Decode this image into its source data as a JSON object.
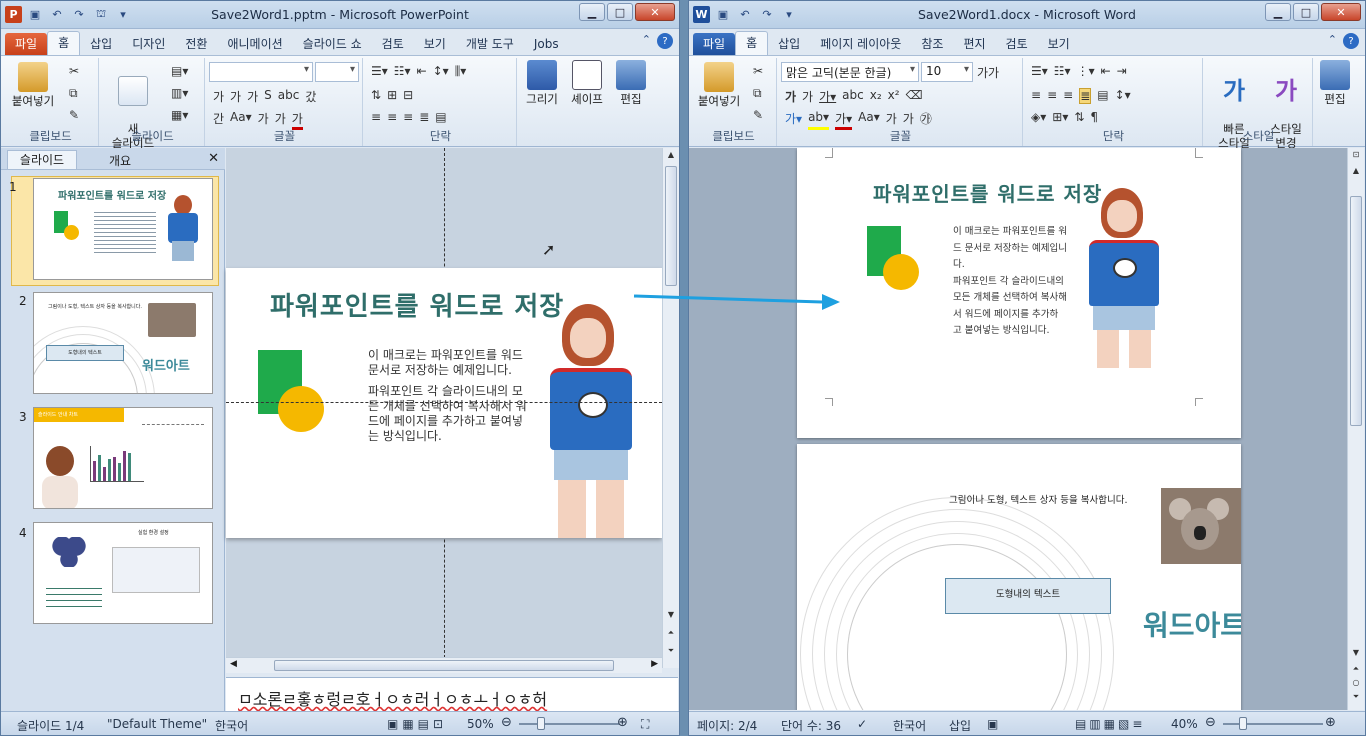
{
  "ppt": {
    "title": "Save2Word1.pptm  -  Microsoft PowerPoint",
    "app_icon": "P",
    "tabs": [
      "파일",
      "홈",
      "삽입",
      "디자인",
      "전환",
      "애니메이션",
      "슬라이드 쇼",
      "검토",
      "보기",
      "개발 도구",
      "Jobs"
    ],
    "active_tab": "홈",
    "groups": {
      "clipboard": {
        "label": "클립보드",
        "paste": "붙여넣기"
      },
      "slides": {
        "label": "슬라이드",
        "new_slide": "새\n슬라이드"
      },
      "font": {
        "label": "글꼴"
      },
      "paragraph": {
        "label": "단락"
      },
      "drawing": "그리기",
      "shape": "셰이프",
      "editing": "편집"
    },
    "pane_tabs": [
      "슬라이드",
      "개요"
    ],
    "thumbs": [
      {
        "num": "1",
        "title": "파워포인트를 워드로 저장"
      },
      {
        "num": "2",
        "line": "그림이나 도형, 텍스트 상자 등을 복사합니다.",
        "box": "도형내의 텍스트",
        "wordart": "워드아트"
      },
      {
        "num": "3",
        "bar": "슬라이드 안내 차트"
      },
      {
        "num": "4",
        "title": "실험 환경 설정"
      }
    ],
    "slide": {
      "title": "파워포인트를 워드로 저장",
      "p1": "이 매크로는 파워포인트를 워드 문서로 저장하는 예제입니다.",
      "p2": "파워포인트 각 슬라이드내의 모든 개체를 선택하여 복사해서  워드에 페이지를 추가하고 붙여넣는 방식입니다."
    },
    "notes": "ㅁ소론ㄹ홓ㅎ렁ㄹ호ㅓㅇㅎ러ㅓㅇㅎㅗㅓㅇㅎ허",
    "status": {
      "slide": "슬라이드 1/4",
      "theme": "\"Default Theme\"",
      "lang": "한국어",
      "zoom": "50%"
    }
  },
  "word": {
    "title": "Save2Word1.docx  -  Microsoft Word",
    "app_icon": "W",
    "tabs": [
      "파일",
      "홈",
      "삽입",
      "페이지 레이아웃",
      "참조",
      "편지",
      "검토",
      "보기"
    ],
    "active_tab": "홈",
    "font_name": "맑은 고딕(본문 한글)",
    "font_size": "10",
    "groups": {
      "clipboard": "클립보드",
      "paste": "붙여넣기",
      "font": "글꼴",
      "paragraph": "단락",
      "styles": "스타일",
      "quick_styles": "빠른\n스타일",
      "change_styles": "스타일\n변경",
      "editing": "편집"
    },
    "page1": {
      "title": "파워포인트를 워드로 저장",
      "lines": [
        "이 매크로는 파워포인트를 워",
        "드 문서로 저장하는 예제입니",
        "다.",
        "파워포인트 각 슬라이드내의",
        "모든 개체를 선택하여 복사해",
        "서  워드에 페이지를 추가하",
        "고 붙여넣는 방식입니다."
      ]
    },
    "page2": {
      "line": "그림이나 도형, 텍스트 상자 등을 복사합니다.",
      "box": "도형내의 텍스트",
      "wordart": "워드아트"
    },
    "status": {
      "page": "페이지: 2/4",
      "words": "단어 수: 36",
      "lang": "한국어",
      "insert": "삽입",
      "zoom": "40%"
    }
  },
  "colors": {
    "ppt_accent": "#c7401a",
    "word_accent": "#1f4f9b",
    "title_teal": "#2f6e6a",
    "green": "#1faa4b",
    "yellow": "#f5b800",
    "arrow": "#1ea0e0",
    "shirt": "#2a6cc0"
  }
}
